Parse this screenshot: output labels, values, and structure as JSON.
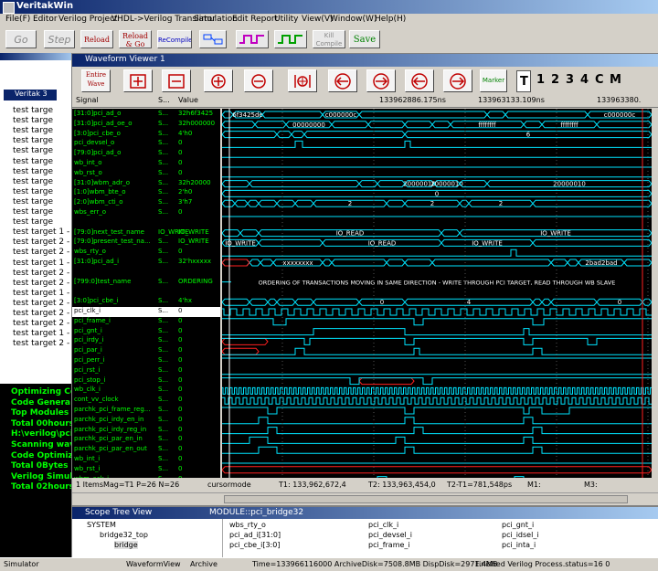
{
  "app": {
    "title": "VeritakWin"
  },
  "menu": [
    "File(F)",
    "Editor",
    "Verilog Project",
    "VHDL->Verilog Translator",
    "Simulation",
    "Edit Report",
    "Utility",
    "View(V)",
    "Window(W)",
    "Help(H)"
  ],
  "toolbar": {
    "go": "Go",
    "step": "Step",
    "reload": "Reload",
    "reload_go": "Reload & Go",
    "recompile": "ReCompile",
    "kill_compile": "Kill Compile",
    "save": "Save"
  },
  "left_panel": {
    "tab": "Veritak 3",
    "lines": [
      "test targe",
      "test targe",
      "test targe",
      "test targe",
      "test targe",
      "test targe",
      "test targe",
      "test targe",
      "test targe",
      "test targe",
      "test targe",
      "test targe",
      "test target 1 -",
      "test target 2 -",
      "test target 2 -",
      "test target 1 -",
      "test target 2 -",
      "test target 2 -",
      "test target 1 -",
      "test target 2 -",
      "test target 2 -",
      "test target 2 -",
      "test target 1 -",
      "test target 2 -"
    ],
    "console": [
      "Optimizing Co",
      "Code Genera",
      "Top Modules a",
      "Total 00hours",
      "H:\\verilog\\pci",
      "Scanning wav",
      "Code Optimize",
      "Total 0Bytes r",
      "Verilog Simul",
      "Total 02hours"
    ]
  },
  "waveform": {
    "title": "Waveform Viewer 1",
    "entire_wave": "Entire Wave",
    "marker": "Marker",
    "tabs": [
      "T",
      "1",
      "2",
      "3",
      "4",
      "C",
      "M"
    ],
    "columns": {
      "signal": "Signal",
      "s": "S...",
      "value": "Value"
    },
    "time_labels": [
      "133962886.175ns",
      "133963133.109ns",
      "133963380."
    ],
    "cursor_label": "cursormode",
    "signals": [
      {
        "name": "[31:0]pci_ad_o",
        "s": "S...",
        "value": "32h6f3425"
      },
      {
        "name": "[31:0]pci_ad_oe_o",
        "s": "S...",
        "value": "32h000000"
      },
      {
        "name": "[3:0]pci_cbe_o",
        "s": "S...",
        "value": "4'h0"
      },
      {
        "name": "pci_devsel_o",
        "s": "S...",
        "value": "0"
      },
      {
        "name": "[79:0]pci_ad_o",
        "s": "S...",
        "value": "0"
      },
      {
        "name": "wb_int_o",
        "s": "S...",
        "value": "0"
      },
      {
        "name": "wb_rst_o",
        "s": "S...",
        "value": "0"
      },
      {
        "name": "[31:0]wbm_adr_o",
        "s": "S...",
        "value": "32h20000"
      },
      {
        "name": "[1:0]wbm_bte_o",
        "s": "S...",
        "value": "2'h0"
      },
      {
        "name": "[2:0]wbm_cti_o",
        "s": "S...",
        "value": "3'h7"
      },
      {
        "name": "wbs_err_o",
        "s": "S...",
        "value": "0"
      },
      {
        "name": "",
        "s": "",
        "value": ""
      },
      {
        "name": "[79:0]next_test_name",
        "s": "IO_WRITE",
        "value": "IO_WRITE"
      },
      {
        "name": "[79:0]present_test_na...",
        "s": "S...",
        "value": "IO_WRITE"
      },
      {
        "name": "wbs_rty_o",
        "s": "S...",
        "value": "0"
      },
      {
        "name": "[31:0]pci_ad_i",
        "s": "S...",
        "value": "32'hxxxxx"
      },
      {
        "name": "",
        "s": "",
        "value": ""
      },
      {
        "name": "[799:0]test_name",
        "s": "S...",
        "value": "ORDERING"
      },
      {
        "name": "",
        "s": "",
        "value": ""
      },
      {
        "name": "[3:0]pci_cbe_i",
        "s": "S...",
        "value": "4'hx"
      },
      {
        "name": "pci_clk_i",
        "s": "S...",
        "value": "0"
      },
      {
        "name": "pci_frame_i",
        "s": "S...",
        "value": "0"
      },
      {
        "name": "pci_gnt_i",
        "s": "S...",
        "value": "0"
      },
      {
        "name": "pci_irdy_i",
        "s": "S...",
        "value": "0"
      },
      {
        "name": "pci_par_i",
        "s": "S...",
        "value": "0"
      },
      {
        "name": "pci_perr_i",
        "s": "S...",
        "value": "0"
      },
      {
        "name": "pci_rst_i",
        "s": "S...",
        "value": "0"
      },
      {
        "name": "pci_stop_i",
        "s": "S...",
        "value": "0"
      },
      {
        "name": "wb_clk_i",
        "s": "S...",
        "value": "0"
      },
      {
        "name": "cont_vv_clock",
        "s": "S...",
        "value": "0"
      },
      {
        "name": "parchk_pci_frame_reg...",
        "s": "S...",
        "value": "0"
      },
      {
        "name": "parchk_pci_irdy_en_in",
        "s": "S...",
        "value": "0"
      },
      {
        "name": "parchk_pci_irdy_reg_in",
        "s": "S...",
        "value": "0"
      },
      {
        "name": "parchk_pci_par_en_in",
        "s": "S...",
        "value": "0"
      },
      {
        "name": "parchk_pci_par_en_out",
        "s": "S...",
        "value": "0"
      },
      {
        "name": "wb_int_i",
        "s": "S...",
        "value": "0"
      },
      {
        "name": "wb_rst_i",
        "s": "S...",
        "value": "0"
      },
      {
        "name": "wbm_ack_i",
        "s": "S...",
        "value": "0"
      },
      {
        "name": "[31:0]wbm_dat_i",
        "s": "S...",
        "value": "32'hxxxxx"
      }
    ],
    "wave_values": {
      "ad_o": [
        "6f3425de",
        "c000000c",
        "aaaaaaaa",
        "c000000c"
      ],
      "ad_oe_o": [
        "00000000",
        "ffffffff",
        "ffffffff"
      ],
      "cbe_o": [
        "0",
        "7",
        "6"
      ],
      "adr": [
        "2000000c",
        "20000010",
        "20000010",
        "20000010"
      ],
      "bte": [
        "0"
      ],
      "cti": [
        "7",
        "7",
        "2",
        "2",
        "2"
      ],
      "next_name": [
        "IO_W...",
        "IO_READ",
        "IO_WRITE"
      ],
      "present_name": [
        "IO_WRITE",
        "IO_READ",
        "IO_WRITE"
      ],
      "ad_i": [
        "xxxxxxxx",
        "a5a5a5a5",
        "2bad2bad"
      ],
      "test_name": "ORDERING OF TRANSACTIONS MOVING IN SAME DIRECTION - WRITE THROUGH PCI TARGET, READ THROUGH WB SLAVE",
      "cbe_i": [
        "0",
        "4",
        "0"
      ]
    },
    "status": {
      "items": "1 Items",
      "mag": "Mag=T1 P=26 N=26",
      "t1": "T1: 133,962,672,4",
      "t2": "T2: 133,963,454,0",
      "t21": "T2-T1=781,548ps",
      "m1": "M1:",
      "m3": "M3:"
    }
  },
  "scope": {
    "title": "Scope Tree View",
    "module": "MODULE::pci_bridge32",
    "tree": [
      "SYSTEM",
      "bridge32_top",
      "bridge"
    ],
    "signals_col1": [
      "wbs_rty_o",
      "pci_ad_i[31:0]",
      "pci_cbe_i[3:0]"
    ],
    "signals_col2": [
      "pci_clk_i",
      "pci_devsel_i",
      "pci_frame_i"
    ],
    "signals_col3": [
      "pci_gnt_i",
      "pci_idsel_i",
      "pci_inta_i"
    ]
  },
  "statusbar": {
    "simulator": "Simulator",
    "waveform": "WaveformView",
    "archive": "Archive",
    "time": "Time=133966116000 ArchiveDisk=7508.8MB DispDisk=2971.4MB",
    "finished": "Finished Verilog Process.status=16 0"
  },
  "colors": {
    "wave": "#00e5ff",
    "signal_text": "#00ff00",
    "bus_x": "#ff2020",
    "cursor": "#ff2020",
    "console_text": "#00ff00"
  }
}
